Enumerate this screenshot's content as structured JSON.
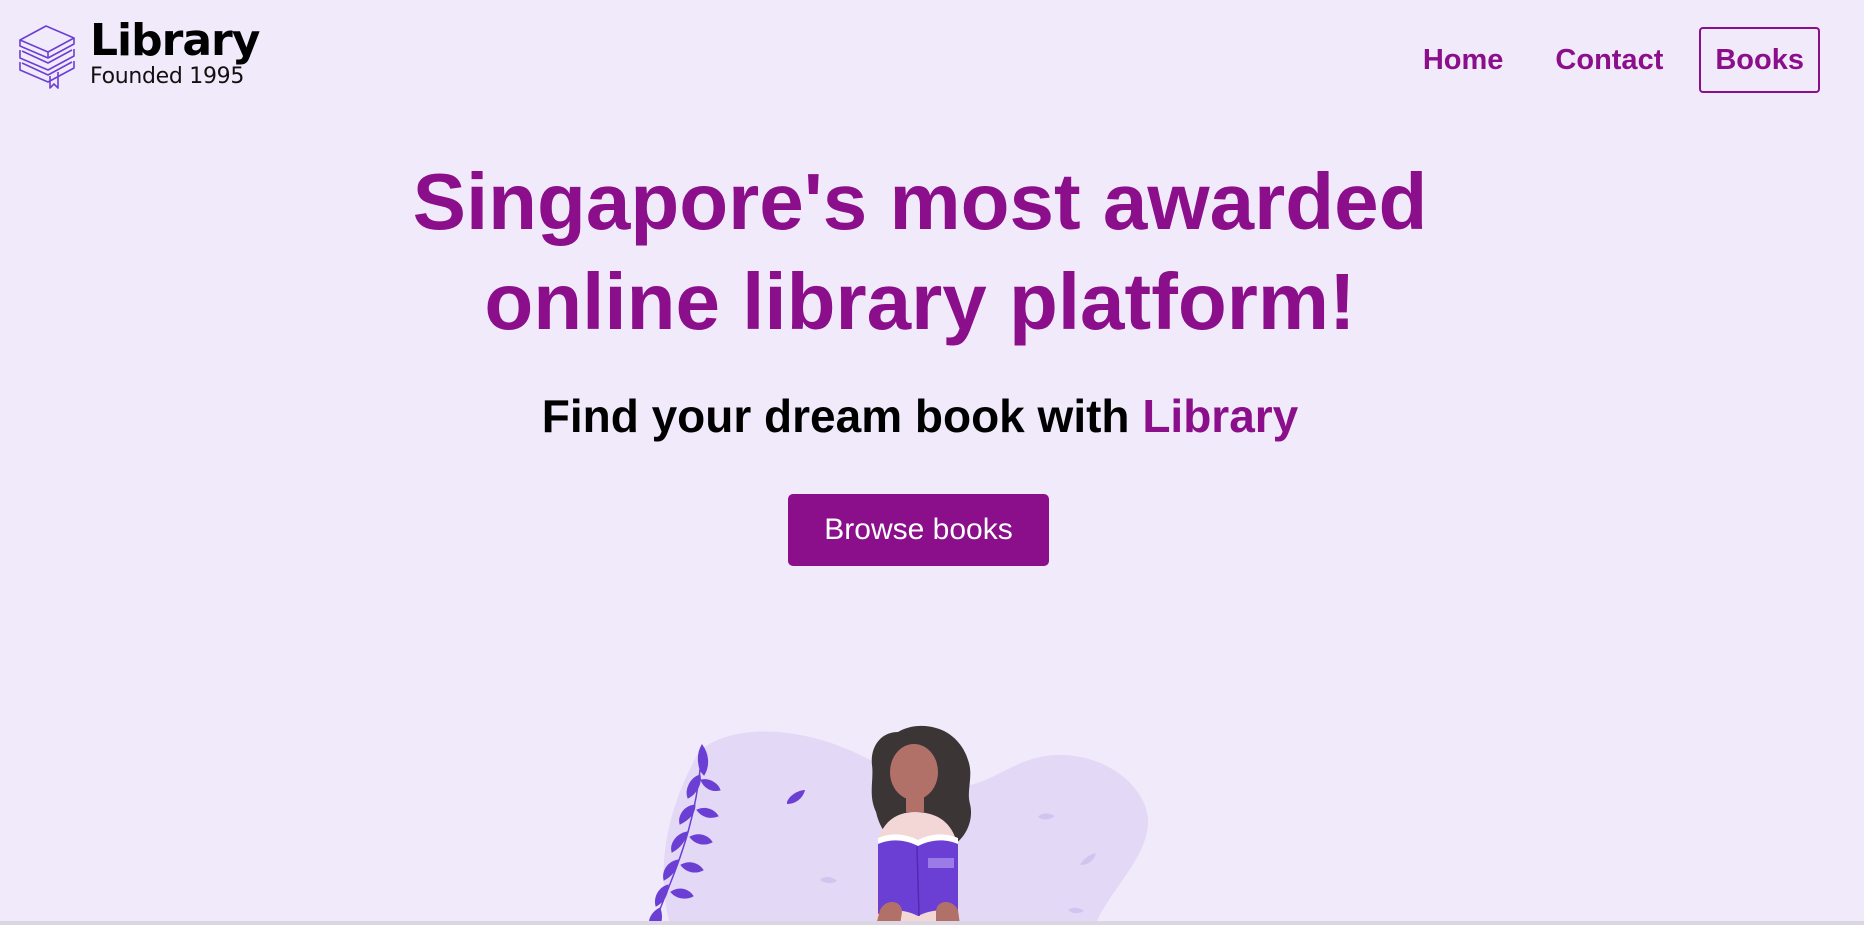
{
  "brand": {
    "name": "Library",
    "tagline": "Founded 1995",
    "icon": "books-stack-icon"
  },
  "nav": {
    "links": [
      {
        "label": "Home",
        "active": false
      },
      {
        "label": "Contact",
        "active": false
      },
      {
        "label": "Books",
        "active": true
      }
    ]
  },
  "hero": {
    "title_line1": "Singapore's most awarded",
    "title_line2": "online library platform!",
    "subtitle_prefix": "Find your dream book with ",
    "subtitle_brand": "Library",
    "cta_label": "Browse books"
  },
  "colors": {
    "background": "#f1eafb",
    "accent": "#8b0e8b",
    "illustration_purple": "#6c3fd4",
    "blob": "#e3d8f5"
  }
}
